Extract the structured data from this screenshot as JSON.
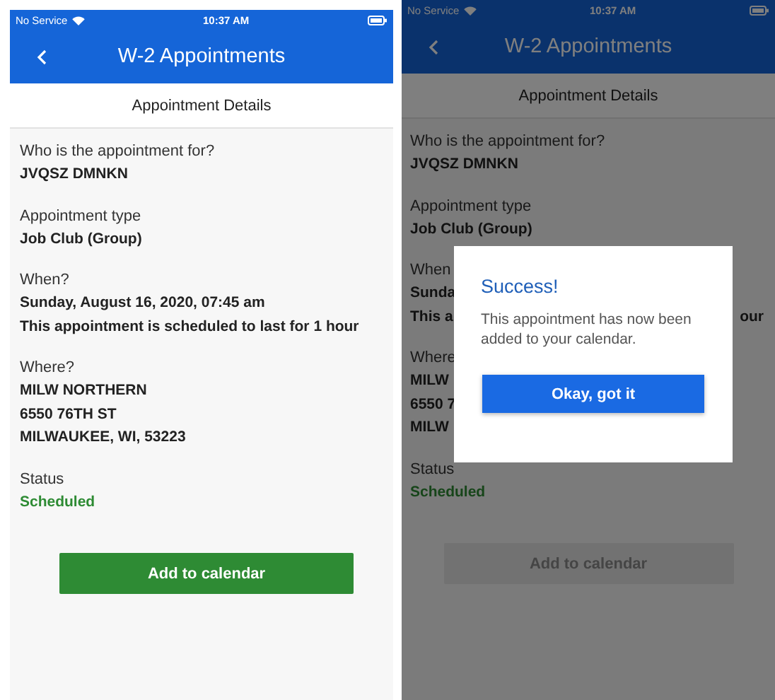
{
  "screens": [
    {
      "status_bar": {
        "carrier": "No Service",
        "time": "10:37 AM"
      },
      "nav": {
        "title": "W-2 Appointments"
      },
      "subheader": "Appointment Details",
      "dimmed": false,
      "sections": [
        {
          "kind": "info",
          "label": "Who is the appointment for?",
          "lines": [
            {
              "text": "JVQSZ DMNKN"
            }
          ]
        },
        {
          "kind": "info",
          "label": "Appointment type",
          "lines": [
            {
              "text": "Job Club (Group)"
            }
          ]
        },
        {
          "kind": "info",
          "label": "When?",
          "lines": [
            {
              "text": "Sunday, August 16, 2020, 07:45 am"
            },
            {
              "text": "This appointment is scheduled to last for 1 hour"
            }
          ]
        },
        {
          "kind": "info",
          "label": "Where?",
          "lines": [
            {
              "text": "MILW NORTHERN"
            },
            {
              "text": "6550 76TH ST"
            },
            {
              "text": "MILWAUKEE, WI, 53223"
            }
          ]
        },
        {
          "kind": "status",
          "label": "Status",
          "lines": [
            {
              "text": "Scheduled"
            }
          ]
        }
      ],
      "button": {
        "label": "Add to calendar",
        "disabled": false
      }
    },
    {
      "status_bar": {
        "carrier": "No Service",
        "time": "10:37 AM"
      },
      "nav": {
        "title": "W-2 Appointments"
      },
      "subheader": "Appointment Details",
      "dimmed": true,
      "sections": [
        {
          "kind": "info",
          "label": "Who is the appointment for?",
          "lines": [
            {
              "text": "JVQSZ DMNKN"
            }
          ]
        },
        {
          "kind": "info",
          "label": "Appointment type",
          "lines": [
            {
              "text": "Job Club (Group)"
            }
          ]
        },
        {
          "kind": "info",
          "label": "When",
          "lines": [
            {
              "text": "Sunda"
            },
            {
              "text": "This a",
              "tail": "our"
            }
          ]
        },
        {
          "kind": "info",
          "label": "Where",
          "lines": [
            {
              "text": "MILW"
            },
            {
              "text": "6550 7"
            },
            {
              "text": "MILW"
            }
          ]
        },
        {
          "kind": "status",
          "label": "Status",
          "lines": [
            {
              "text": "Scheduled"
            }
          ]
        }
      ],
      "button": {
        "label": "Add to calendar",
        "disabled": true
      },
      "dialog": {
        "title": "Success!",
        "message": "This appointment has now been added to your calendar.",
        "button": "Okay, got it"
      }
    }
  ]
}
